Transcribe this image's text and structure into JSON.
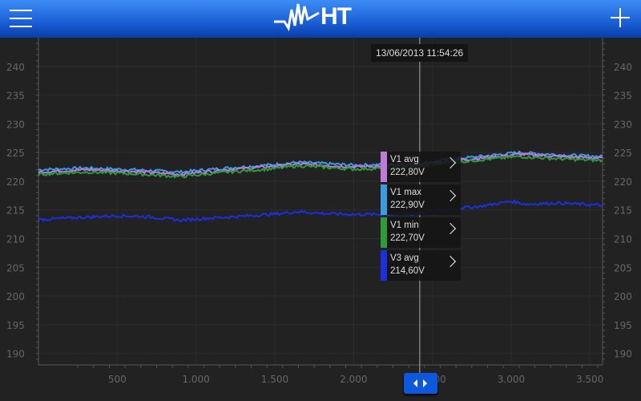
{
  "header": {
    "logo": "HT",
    "menu_icon": "hamburger-menu-icon",
    "add_icon": "plus-icon"
  },
  "cursor": {
    "timestamp": "13/06/2013 11:54:26",
    "x": 2420
  },
  "legend": [
    {
      "name": "V1 avg",
      "value": "222,80V",
      "color": "#c07ad8"
    },
    {
      "name": "V1 max",
      "value": "222,90V",
      "color": "#3a9be0"
    },
    {
      "name": "V1 min",
      "value": "222,70V",
      "color": "#2e9b3a"
    },
    {
      "name": "V3 avg",
      "value": "214,60V",
      "color": "#1b2fe0"
    }
  ],
  "chart_data": {
    "type": "line",
    "xlim": [
      0,
      3580
    ],
    "ylim": [
      188,
      245
    ],
    "x_ticks": [
      "500",
      "1.000",
      "1.500",
      "2.000",
      "2.500",
      "3.000",
      "3.500"
    ],
    "x_tick_values": [
      500,
      1000,
      1500,
      2000,
      2500,
      3000,
      3500
    ],
    "y_ticks": [
      240,
      235,
      230,
      225,
      220,
      215,
      210,
      205,
      200,
      195,
      190
    ],
    "grid": true,
    "series": [
      {
        "name": "V1 max",
        "color": "#3a9be0",
        "x": [
          0,
          300,
          600,
          900,
          1200,
          1500,
          1650,
          2000,
          2400,
          2600,
          2800,
          3050,
          3300,
          3580
        ],
        "y": [
          222.0,
          222.3,
          222.0,
          221.6,
          222.3,
          222.9,
          223.3,
          222.8,
          223.0,
          223.8,
          224.3,
          225.0,
          224.6,
          224.3
        ]
      },
      {
        "name": "V1 avg",
        "color": "#c07ad8",
        "x": [
          0,
          300,
          600,
          900,
          1200,
          1500,
          1650,
          2000,
          2400,
          2600,
          2800,
          3050,
          3300,
          3580
        ],
        "y": [
          221.6,
          222.0,
          221.7,
          221.2,
          222.0,
          222.6,
          223.0,
          222.5,
          222.8,
          223.5,
          224.0,
          224.7,
          224.3,
          224.0
        ]
      },
      {
        "name": "V1 min",
        "color": "#2e9b3a",
        "x": [
          0,
          300,
          600,
          900,
          1200,
          1500,
          1650,
          2000,
          2400,
          2600,
          2800,
          3050,
          3300,
          3580
        ],
        "y": [
          221.2,
          221.6,
          221.3,
          220.8,
          221.6,
          222.2,
          222.7,
          222.1,
          222.4,
          223.2,
          223.7,
          224.3,
          223.9,
          223.6
        ]
      },
      {
        "name": "V3 avg",
        "color": "#1b2fe0",
        "x": [
          0,
          200,
          500,
          700,
          900,
          1100,
          1300,
          1500,
          1650,
          1800,
          2000,
          2400,
          2600,
          2800,
          3000,
          3100,
          3300,
          3580
        ],
        "y": [
          213.3,
          213.6,
          214.0,
          213.8,
          213.2,
          213.6,
          213.9,
          214.3,
          214.7,
          214.4,
          214.2,
          214.3,
          215.2,
          215.6,
          216.5,
          216.0,
          216.2,
          215.8
        ]
      }
    ]
  }
}
